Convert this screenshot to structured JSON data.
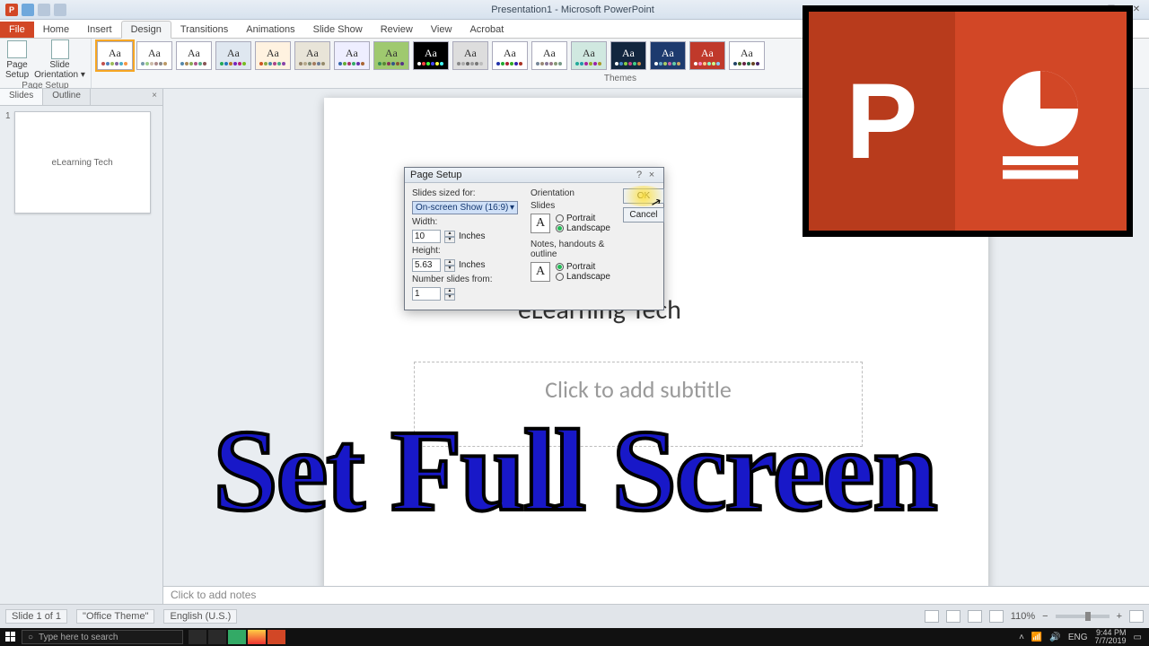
{
  "titlebar": {
    "title": "Presentation1 - Microsoft PowerPoint"
  },
  "window_controls": {
    "min": "─",
    "max": "☐",
    "close": "✕"
  },
  "ribbon": {
    "file": "File",
    "tabs": [
      "Home",
      "Insert",
      "Design",
      "Transitions",
      "Animations",
      "Slide Show",
      "Review",
      "View",
      "Acrobat"
    ],
    "active_tab_index": 2,
    "page_setup_group": {
      "label": "Page Setup",
      "page_setup": "Page\nSetup",
      "slide_orientation": "Slide\nOrientation ▾"
    },
    "themes_label": "Themes"
  },
  "leftpane": {
    "tabs": [
      "Slides",
      "Outline"
    ],
    "close": "×",
    "thumbs": [
      {
        "num": "1",
        "caption": "eLearning Tech"
      }
    ]
  },
  "slide": {
    "title": "eLearning Tech",
    "subtitle_placeholder": "Click to add subtitle"
  },
  "notes": {
    "placeholder": "Click to add notes"
  },
  "statusbar": {
    "slide_of": "Slide 1 of 1",
    "theme": "\"Office Theme\"",
    "lang": "English (U.S.)",
    "zoom": "110%"
  },
  "taskbar": {
    "search_placeholder": "Type here to search",
    "lang": "ENG",
    "time": "9:44 PM",
    "date": "7/7/2019"
  },
  "dialog": {
    "title": "Page Setup",
    "help": "?",
    "close": "×",
    "sized_for_label": "Slides sized for:",
    "sized_for_value": "On-screen Show (16:9)",
    "width_label": "Width:",
    "width_value": "10",
    "width_unit": "Inches",
    "height_label": "Height:",
    "height_value": "5.63",
    "height_unit": "Inches",
    "number_from_label": "Number slides from:",
    "number_from_value": "1",
    "orientation_label": "Orientation",
    "slides_group": "Slides",
    "portrait": "Portrait",
    "landscape": "Landscape",
    "notes_group": "Notes, handouts & outline",
    "ok": "OK",
    "cancel": "Cancel"
  },
  "overlay": {
    "headline": "Set Full Screen",
    "p_letter": "P"
  }
}
